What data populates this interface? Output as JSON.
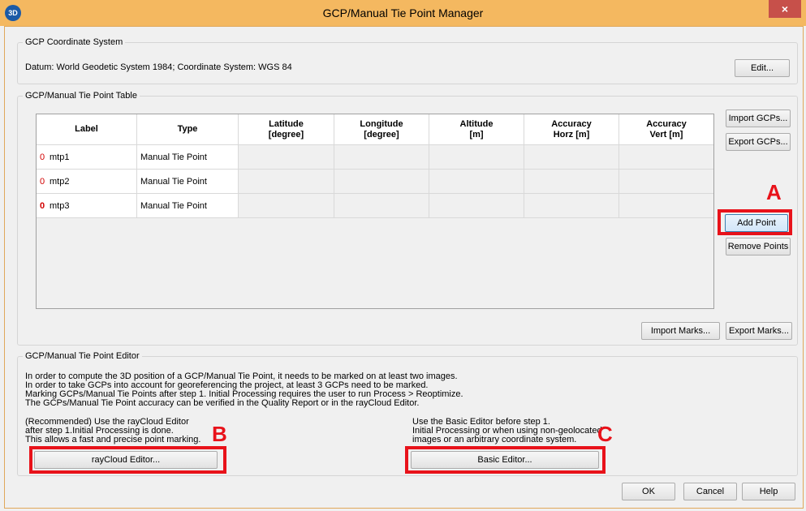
{
  "window": {
    "title": "GCP/Manual Tie Point Manager",
    "app_icon": "3D",
    "close_glyph": "×"
  },
  "coordinate_system": {
    "legend": "GCP Coordinate System",
    "description": "Datum: World Geodetic System 1984; Coordinate System: WGS 84",
    "edit_label": "Edit..."
  },
  "table_section": {
    "legend": "GCP/Manual Tie Point Table",
    "columns": [
      "Label",
      "Type",
      "Latitude\n[degree]",
      "Longitude\n[degree]",
      "Altitude\n[m]",
      "Accuracy\nHorz [m]",
      "Accuracy\nVert [m]"
    ],
    "rows": [
      {
        "marker": "0",
        "label": "mtp1",
        "type": "Manual Tie Point"
      },
      {
        "marker": "0",
        "label": "mtp2",
        "type": "Manual Tie Point"
      },
      {
        "marker": "0",
        "label": "mtp3",
        "type": "Manual Tie Point"
      }
    ],
    "buttons": {
      "import_gcps": "Import GCPs...",
      "export_gcps": "Export GCPs...",
      "add_point": "Add Point",
      "remove_points": "Remove Points",
      "import_marks": "Import Marks...",
      "export_marks": "Export Marks..."
    }
  },
  "editor": {
    "legend": "GCP/Manual Tie Point Editor",
    "info_lines": [
      "In order to compute the 3D position of a GCP/Manual Tie Point, it needs to be marked on at least two images.",
      "In order to take GCPs into account for georeferencing the project, at least 3 GCPs need to be marked.",
      "Marking GCPs/Manual Tie Points after step 1. Initial Processing requires the user to run Process > Reoptimize.",
      "The GCPs/Manual Tie Point accuracy can be verified in the Quality Report or in the rayCloud Editor."
    ],
    "raycloud_lines": [
      "(Recommended) Use the rayCloud Editor",
      "after step 1.Initial Processing is done.",
      "This allows a fast and precise point marking."
    ],
    "basic_lines": [
      "Use the Basic Editor before step 1.",
      "Initial Processing or when using non-geolocated",
      "images or an arbitrary coordinate system."
    ],
    "raycloud_button": "rayCloud Editor...",
    "basic_button": "Basic Editor..."
  },
  "footer": {
    "ok": "OK",
    "cancel": "Cancel",
    "help": "Help"
  },
  "annotations": {
    "a": "A",
    "b": "B",
    "c": "C",
    "highlight_color": "#e8121a"
  }
}
